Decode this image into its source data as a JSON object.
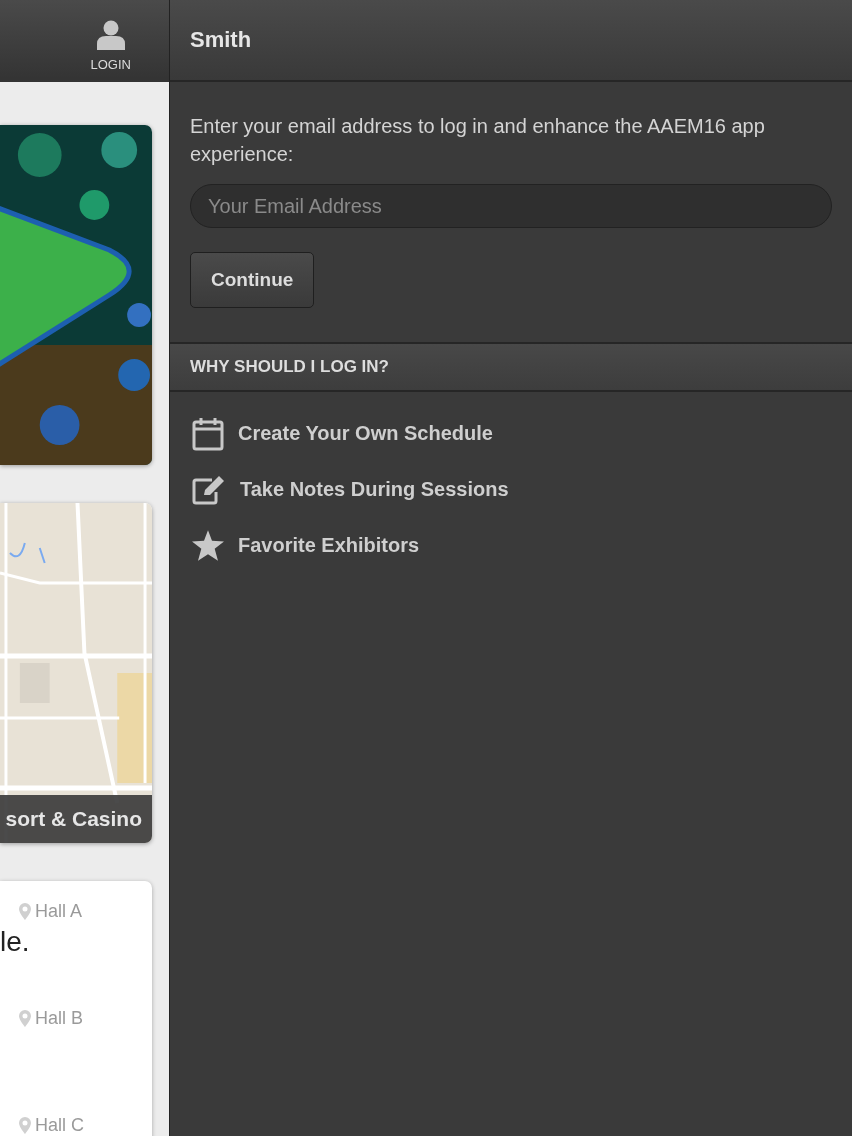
{
  "sidebar": {
    "login_button": {
      "label": "LOGIN"
    },
    "cards": [
      {
        "kind": "picture"
      },
      {
        "kind": "map",
        "caption": "sort & Casino"
      },
      {
        "kind": "sessions",
        "text": "le.",
        "halls": [
          "Hall A",
          "Hall B",
          "Hall C"
        ]
      }
    ]
  },
  "panel": {
    "title": "Smith",
    "intro": "Enter your email address to log in and enhance the AAEM16 app experience:",
    "email": {
      "placeholder": "Your Email Address"
    },
    "continue_button": "Continue",
    "section_title": "WHY SHOULD I LOG IN?",
    "benefits": [
      {
        "kind": "calendar",
        "label": "Create Your Own Schedule"
      },
      {
        "kind": "note",
        "label": "Take Notes During Sessions"
      },
      {
        "kind": "star",
        "label": "Favorite Exhibitors"
      }
    ]
  }
}
